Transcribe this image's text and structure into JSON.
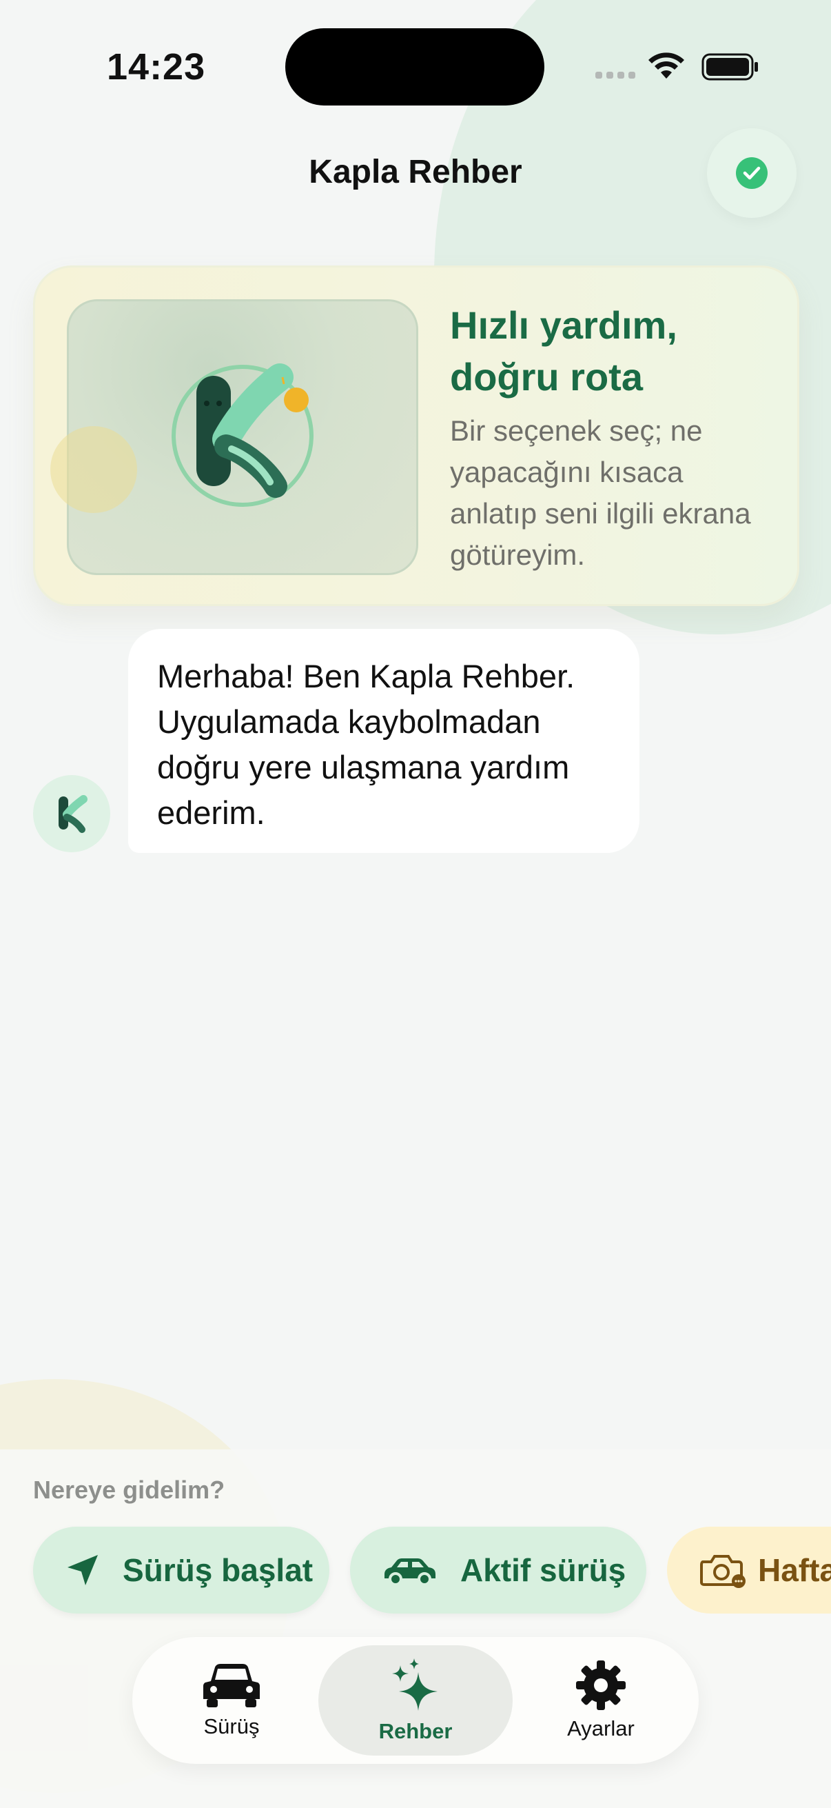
{
  "status_bar": {
    "time": "14:23"
  },
  "header": {
    "title": "Kapla Rehber",
    "status_icon": "check-circle-icon"
  },
  "hero": {
    "title": "Hızlı yardım, doğru rota",
    "description": "Bir seçenek seç; ne yapacağını kısaca anlatıp seni ilgili ekrana götüreyim.",
    "mascot": "k-mascot-logo"
  },
  "chat": {
    "messages": [
      {
        "sender": "assistant",
        "text": "Merhaba! Ben Kapla Rehber. Uygulamada kaybolmadan doğru yere ulaşmana yardım ederim."
      }
    ]
  },
  "quick_actions": {
    "label": "Nereye gidelim?",
    "chips": [
      {
        "label": "Sürüş başlat",
        "icon": "navigation-arrow-icon"
      },
      {
        "label": "Aktif sürüş",
        "icon": "car-icon"
      },
      {
        "label": "Hafta",
        "icon": "camera-icon"
      }
    ]
  },
  "tab_bar": {
    "tabs": [
      {
        "label": "Sürüş",
        "icon": "car-icon",
        "active": false
      },
      {
        "label": "Rehber",
        "icon": "sparkles-icon",
        "active": true
      },
      {
        "label": "Ayarlar",
        "icon": "gear-icon",
        "active": false
      }
    ]
  },
  "colors": {
    "accent": "#1a6b45",
    "success": "#37c178",
    "chip_green": "#d8f0df",
    "chip_yellow": "#fdf1cc"
  }
}
